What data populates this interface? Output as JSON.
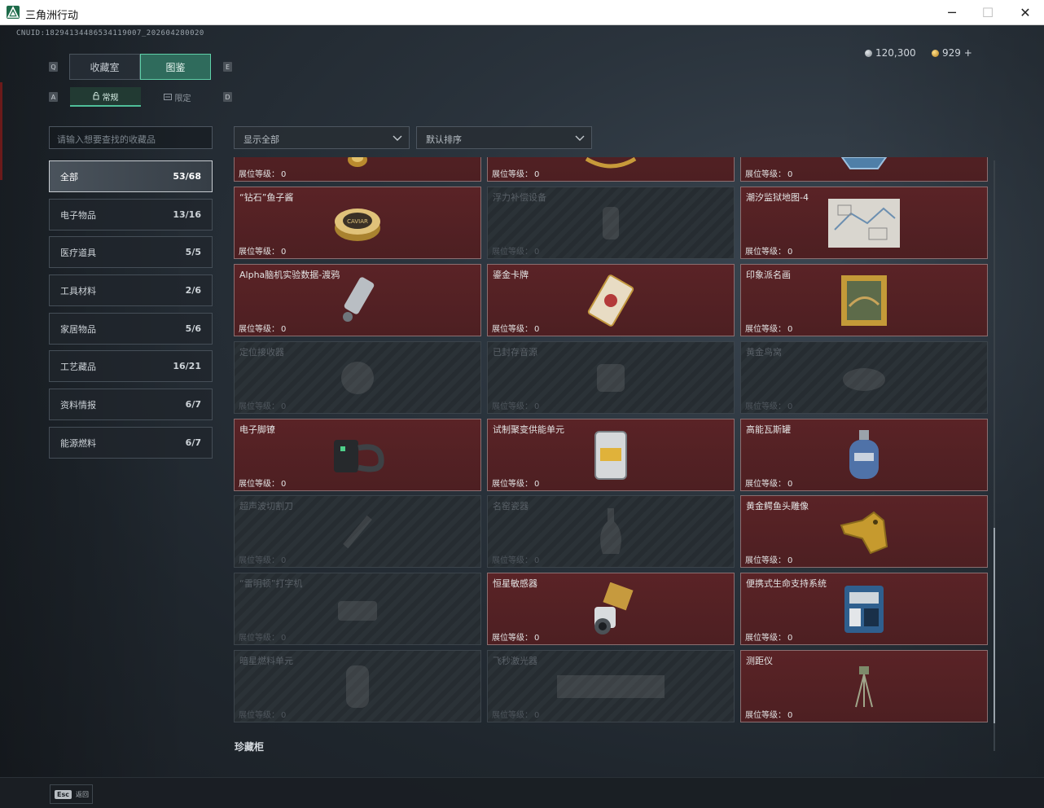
{
  "window": {
    "title": "三角洲行动",
    "minimize": "─",
    "maximize": "☐",
    "close": "✕"
  },
  "uid": "CNUID:18294134486534119007_202604280020",
  "currency": [
    {
      "value": "120,300",
      "color": "#9aa3ab"
    },
    {
      "value": "929 +",
      "color": "#d9a94a"
    }
  ],
  "key_hints": {
    "tab_left": "Q",
    "tab_right": "E",
    "sub_left": "A",
    "sub_right": "D"
  },
  "tabs": [
    {
      "label": "收藏室",
      "active": false
    },
    {
      "label": "图鉴",
      "active": true
    }
  ],
  "sub_tabs": [
    {
      "label": "常规",
      "icon": "lock-open-icon",
      "active": true
    },
    {
      "label": "限定",
      "icon": "limited-icon",
      "active": false
    }
  ],
  "search": {
    "placeholder": "请输入想要查找的收藏品"
  },
  "filters": {
    "show": "显示全部",
    "sort": "默认排序"
  },
  "categories": [
    {
      "label": "全部",
      "count": "53/68",
      "active": true
    },
    {
      "label": "电子物品",
      "count": "13/16"
    },
    {
      "label": "医疗道具",
      "count": "5/5"
    },
    {
      "label": "工具材料",
      "count": "2/6"
    },
    {
      "label": "家居物品",
      "count": "5/6"
    },
    {
      "label": "工艺藏品",
      "count": "16/21"
    },
    {
      "label": "资料情报",
      "count": "6/7"
    },
    {
      "label": "能源燃料",
      "count": "6/7"
    }
  ],
  "level_label": "展位等级：",
  "items": [
    {
      "name": "",
      "level": "0",
      "owned": true,
      "icon": "gold-ornament-icon"
    },
    {
      "name": "",
      "level": "0",
      "owned": true,
      "icon": "gold-bracelet-icon"
    },
    {
      "name": "",
      "level": "0",
      "owned": true,
      "icon": "blue-device-icon"
    },
    {
      "name": "“钻石”鱼子酱",
      "level": "0",
      "owned": true,
      "icon": "caviar-tin-icon"
    },
    {
      "name": "浮力补偿设备",
      "level": "0",
      "owned": false,
      "icon": "diving-gear-icon"
    },
    {
      "name": "潮汐监狱地图-4",
      "level": "0",
      "owned": true,
      "icon": "map-icon"
    },
    {
      "name": "Alpha脑机实验数据-渡鸦",
      "level": "0",
      "owned": true,
      "icon": "data-drive-icon"
    },
    {
      "name": "鎏金卡牌",
      "level": "0",
      "owned": true,
      "icon": "tarot-card-icon"
    },
    {
      "name": "印象派名画",
      "level": "0",
      "owned": true,
      "icon": "painting-icon"
    },
    {
      "name": "定位接收器",
      "level": "0",
      "owned": false,
      "icon": "receiver-icon"
    },
    {
      "name": "已封存音源",
      "level": "0",
      "owned": false,
      "icon": "audio-source-icon"
    },
    {
      "name": "黄金鸟窝",
      "level": "0",
      "owned": false,
      "icon": "bird-nest-icon"
    },
    {
      "name": "电子脚镣",
      "level": "0",
      "owned": true,
      "icon": "ankle-monitor-icon"
    },
    {
      "name": "试制聚变供能单元",
      "level": "0",
      "owned": true,
      "icon": "fusion-cell-icon"
    },
    {
      "name": "高能瓦斯罐",
      "level": "0",
      "owned": true,
      "icon": "gas-canister-icon"
    },
    {
      "name": "超声波切割刀",
      "level": "0",
      "owned": false,
      "icon": "cutter-icon"
    },
    {
      "name": "名窑瓷器",
      "level": "0",
      "owned": false,
      "icon": "vase-icon"
    },
    {
      "name": "黄金鳄鱼头雕像",
      "level": "0",
      "owned": true,
      "icon": "crocodile-statue-icon"
    },
    {
      "name": "“雷明顿”打字机",
      "level": "0",
      "owned": false,
      "icon": "typewriter-icon"
    },
    {
      "name": "恒星敏感器",
      "level": "0",
      "owned": true,
      "icon": "star-sensor-icon"
    },
    {
      "name": "便携式生命支持系统",
      "level": "0",
      "owned": true,
      "icon": "life-support-icon"
    },
    {
      "name": "暗星燃料单元",
      "level": "0",
      "owned": false,
      "icon": "fuel-cell-icon"
    },
    {
      "name": "飞秒激光器",
      "level": "0",
      "owned": false,
      "icon": "laser-icon"
    },
    {
      "name": "测距仪",
      "level": "0",
      "owned": true,
      "icon": "rangefinder-icon"
    }
  ],
  "section_title": "珍藏柜",
  "footer": {
    "esc_key": "Esc",
    "esc_label": "返回"
  }
}
